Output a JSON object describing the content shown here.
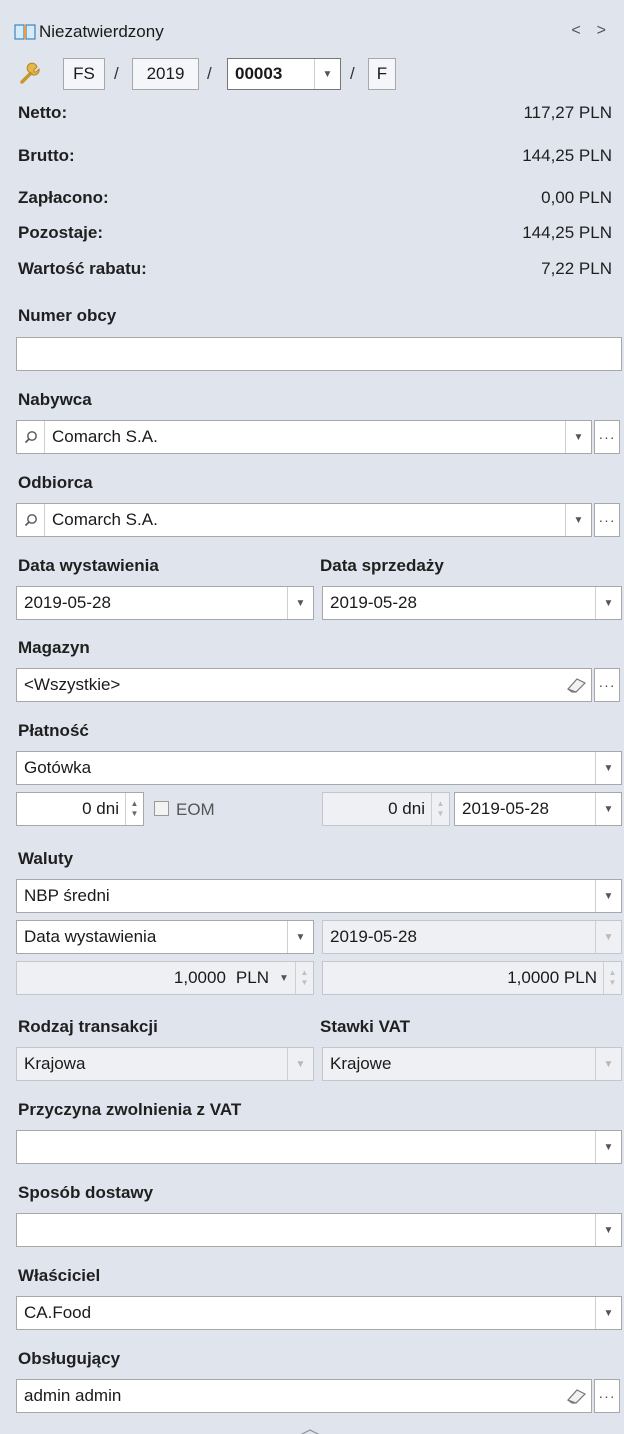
{
  "header": {
    "status": "Niezatwierdzony",
    "prev": "<",
    "next": ">"
  },
  "docnum": {
    "type": "FS",
    "year": "2019",
    "number": "00003",
    "suffix": "F",
    "sep": "/"
  },
  "summary": [
    {
      "label": "Netto:",
      "value": "117,27 PLN"
    },
    {
      "label": "Brutto:",
      "value": "144,25 PLN"
    },
    {
      "label": "Zapłacono:",
      "value": "0,00 PLN"
    },
    {
      "label": "Pozostaje:",
      "value": "144,25 PLN"
    },
    {
      "label": "Wartość rabatu:",
      "value": "7,22 PLN"
    }
  ],
  "numer_obcy": {
    "label": "Numer obcy",
    "value": ""
  },
  "nabywca": {
    "label": "Nabywca",
    "value": "Comarch S.A."
  },
  "odbiorca": {
    "label": "Odbiorca",
    "value": "Comarch S.A."
  },
  "data_wystawienia": {
    "label": "Data wystawienia",
    "value": "2019-05-28"
  },
  "data_sprzedazy": {
    "label": "Data sprzedaży",
    "value": "2019-05-28"
  },
  "magazyn": {
    "label": "Magazyn",
    "value": "<Wszystkie>"
  },
  "platnosc": {
    "label": "Płatność",
    "value": "Gotówka",
    "days": "0 dni",
    "eom": "EOM",
    "days2": "0 dni",
    "date": "2019-05-28"
  },
  "waluty": {
    "label": "Waluty",
    "value": "NBP średni",
    "date_type": "Data wystawienia",
    "date": "2019-05-28",
    "rate": "1,0000",
    "currency": "PLN",
    "rate2": "1,0000 PLN"
  },
  "rodzaj_transakcji": {
    "label": "Rodzaj transakcji",
    "value": "Krajowa"
  },
  "stawki_vat": {
    "label": "Stawki VAT",
    "value": "Krajowe"
  },
  "przyczyna": {
    "label": "Przyczyna zwolnienia z VAT",
    "value": ""
  },
  "sposob_dostawy": {
    "label": "Sposób dostawy",
    "value": ""
  },
  "wlasciciel": {
    "label": "Właściciel",
    "value": "CA.Food"
  },
  "obslugujacy": {
    "label": "Obsługujący",
    "value": "admin admin"
  },
  "colors": {
    "panel": "#dfe4ed",
    "field": "#ffffff",
    "disabled": "#eef0f3",
    "icon_gold": "#d9a531"
  }
}
